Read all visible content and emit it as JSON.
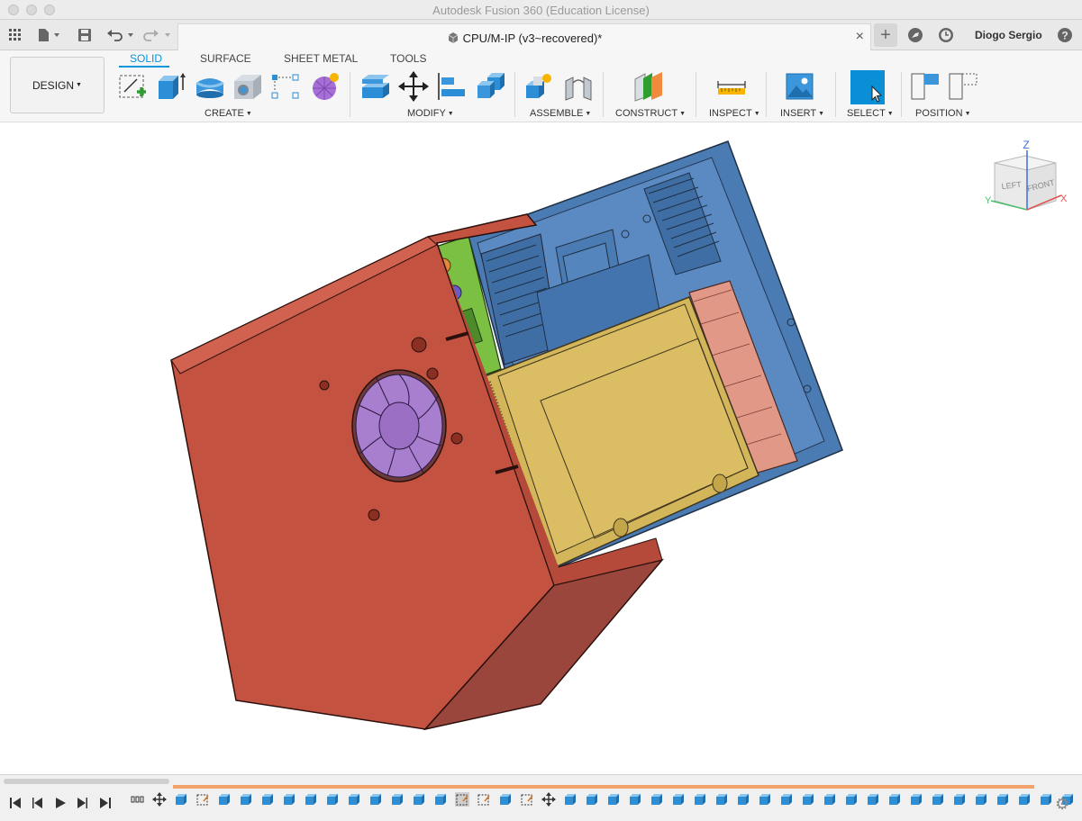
{
  "window": {
    "title": "Autodesk Fusion 360 (Education License)"
  },
  "tabbar": {
    "document_title": "CPU/M-IP (v3~recovered)*",
    "close_glyph": "×",
    "new_tab_glyph": "+",
    "user_name": "Diogo Sergio",
    "icons": [
      "grid-icon",
      "file-icon",
      "save-icon",
      "undo-icon",
      "redo-icon",
      "new-tab-icon",
      "extensions-icon",
      "job-status-icon",
      "help-icon"
    ]
  },
  "toolbar": {
    "workspace": "DESIGN",
    "tabs": [
      {
        "label": "SOLID",
        "active": true
      },
      {
        "label": "SURFACE",
        "active": false
      },
      {
        "label": "SHEET METAL",
        "active": false
      },
      {
        "label": "TOOLS",
        "active": false
      }
    ],
    "groups": {
      "create": "CREATE",
      "modify": "MODIFY",
      "assemble": "ASSEMBLE",
      "construct": "CONSTRUCT",
      "inspect": "INSPECT",
      "insert": "INSERT",
      "select": "SELECT",
      "position": "POSITION"
    },
    "dropdown_caret": "▼"
  },
  "viewport": {
    "model": "CPU enclosure assembly",
    "colors": {
      "shell": "#c45240",
      "shell_side": "#b54a3b",
      "shell_bottom": "#9a463d",
      "chassis": "#4b7bb3",
      "drive": "#d4b65a",
      "board": "#7bc043",
      "fan": "#a77fce",
      "module": "#e29886"
    }
  },
  "viewcube": {
    "left": "LEFT",
    "front": "FRONT",
    "z": "Z",
    "x": "X",
    "y": "Y"
  },
  "timeline": {
    "controls": [
      "rewind-icon",
      "step-back-icon",
      "play-icon",
      "step-forward-icon",
      "end-icon"
    ],
    "accent": "#f4a46a",
    "settings_icon": "gear-icon"
  }
}
